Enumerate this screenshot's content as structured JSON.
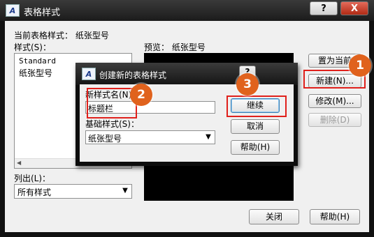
{
  "outer": {
    "title": "表格样式",
    "help_btn": "?",
    "close_btn": "X",
    "current_style_label": "当前表格样式： 纸张型号",
    "styles_label": "样式(S)：",
    "styles": [
      "Standard",
      "纸张型号"
    ],
    "preview_label": "预览： 纸张型号",
    "set_current": "置为当前",
    "new": "新建(N)...",
    "modify": "修改(M)...",
    "delete": "删除(D)",
    "list_label": "列出(L)：",
    "list_value": "所有样式",
    "close": "关闭",
    "help": "帮助(H)"
  },
  "inner": {
    "title": "创建新的表格样式",
    "help_btn": "?",
    "new_name_label": "新样式名(N)：",
    "new_name_value": "标题栏",
    "base_style_label": "基础样式(S)：",
    "base_style_value": "纸张型号",
    "continue": "继续",
    "cancel": "取消",
    "help": "帮助(H)"
  },
  "badges": [
    "1",
    "2",
    "3"
  ],
  "icons": {
    "app": "autocad-icon",
    "dropdown": "chevron-down-icon",
    "scroll_left": "arrow-left-icon",
    "scroll_right": "arrow-right-icon"
  },
  "colors": {
    "highlight": "#e0201b",
    "badge": "#e0621d"
  }
}
